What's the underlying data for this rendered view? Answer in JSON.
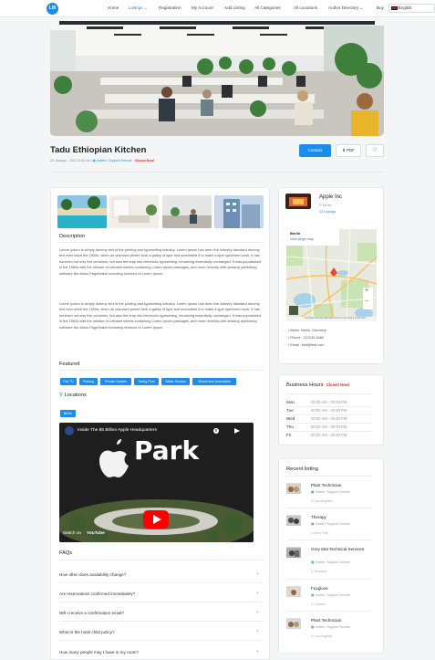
{
  "header": {
    "logo_text": "LM",
    "nav": [
      {
        "label": "Home"
      },
      {
        "label": "Listings ⌄"
      },
      {
        "label": "Registration"
      },
      {
        "label": "My Account"
      },
      {
        "label": "Add Listing"
      },
      {
        "label": "All Categories"
      },
      {
        "label": "All Locations"
      },
      {
        "label": "Author Directory ⌄"
      },
      {
        "label": "Buy"
      }
    ],
    "language": "English"
  },
  "listing": {
    "title": "Tadu Ethiopian Kitchen",
    "date": "25 January , 2022 11:54 am",
    "category": "Hotels / Support Service",
    "status": "Closed Now!",
    "contact_label": "Contact",
    "pdf_label": "PDF",
    "heart_icon": "♡"
  },
  "description": {
    "title": "Description",
    "paragraphs": [
      "Lorem Ipsum is simply dummy text of the printing and typesetting industry. Lorem Ipsum has been the industry standard dummy text ever since the 1500s, when an unknown printer took a galley of type and scrambled it to make a type specimen book. It has survived not only five centuries, but also the leap into electronic typesetting, remaining essentially unchanged. It was popularised in the 1960s with the release of Letraset sheets containing Lorem Ipsum passages, and more recently with desktop publishing software like Aldus PageMaker including versions of Lorem Ipsum.",
      "Lorem Ipsum is simply dummy text of the printing and typesetting industry. Lorem Ipsum has been the industry standard dummy text ever since the 1500s, when an unknown printer took a galley of type and scrambled it to make a type specimen book. It has survived not only five centuries, but also the leap into electronic typesetting, remaining essentially unchanged. It was popularised in the 1960s with the release of Letraset sheets containing Lorem Ipsum passages, and more recently with desktop publishing software like Aldus PageMaker including versions of Lorem Ipsum."
    ]
  },
  "featured": {
    "title": "Featured",
    "tags": [
      "Flat TV",
      "Parking",
      "Private Garden",
      "Swing Pool",
      "Water Service",
      "Wheelchair Accessible"
    ]
  },
  "locations": {
    "title": "Locations",
    "tag": "Berlin"
  },
  "video": {
    "title": "Inside The $5 Billion Apple Headquarters",
    "overlay_word": "Park",
    "watch_on": "Watch on",
    "youtube": "YouTube"
  },
  "faqs": {
    "title": "FAQs",
    "items": [
      "How often does availability change?",
      "Are reservations confirmed immediately?",
      "Will I receive a confirmation email?",
      "What is the hotel child policy?",
      "How many people may I have in my room?"
    ]
  },
  "author": {
    "name": "Apple Inc",
    "location": "Berlin",
    "listings": "12 Listings"
  },
  "map": {
    "place": "Berlin",
    "link": "View larger map",
    "attribution": "Keyboard shortcuts   Map Data   Terms of Use   Report a map error"
  },
  "contact": [
    "Berlin, Berlin, Germany",
    "Phone : 212245-4686",
    "Email : test@test.com"
  ],
  "business_hours": {
    "title": "Business Hours",
    "status": "Closed Now!",
    "rows": [
      {
        "day": "Mon",
        "time": "00:00 AM - 00:00 PM"
      },
      {
        "day": "Tue",
        "time": "00:00 AM - 00:00 PM"
      },
      {
        "day": "Wed",
        "time": "00:00 AM - 00:00 PM"
      },
      {
        "day": "Thu",
        "time": "00:00 AM - 00:00 PM"
      },
      {
        "day": "Fri",
        "time": "00:00 AM - 00:00 PM"
      }
    ]
  },
  "recent": {
    "title": "Recent listing",
    "items": [
      {
        "title": "Plant Technician",
        "category": "Hotels / Support Service",
        "location": "Los Angeles"
      },
      {
        "title": "Therapy",
        "category": "Hotels / Support Service",
        "location": "New York"
      },
      {
        "title": "Grey Mat Technical Services",
        "category": "Hotels / Support Service",
        "location": "Houston"
      },
      {
        "title": "Foxglove",
        "category": "Hotels / Support Service",
        "location": "London"
      },
      {
        "title": "Plant Technician",
        "category": "Hotels / Support Service",
        "location": "Los Angeles"
      }
    ]
  },
  "colors": {
    "accent": "#1a8ee8",
    "closed": "#e52a2a",
    "page_bg": "#f4f5f7"
  }
}
